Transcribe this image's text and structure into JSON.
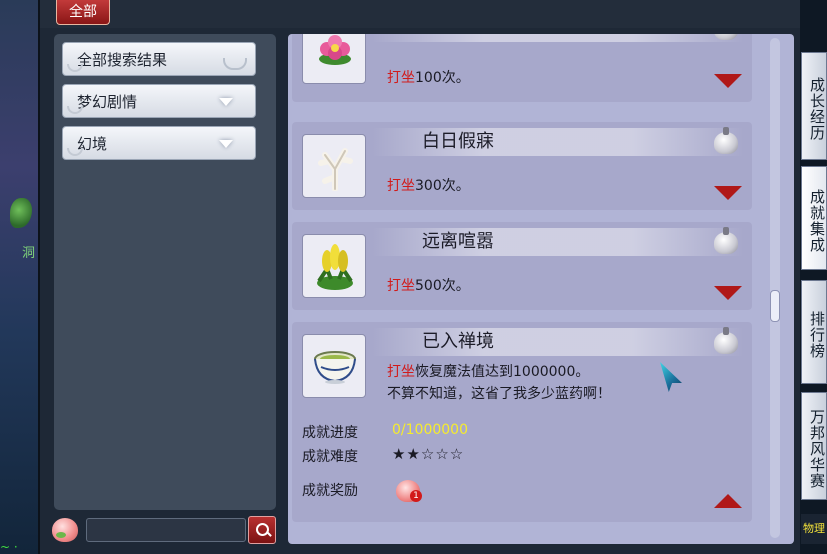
{
  "window": {
    "top_tab": "全部"
  },
  "sidebar": {
    "items": [
      {
        "label": "全部搜索结果",
        "has_dropdown": false
      },
      {
        "label": "梦幻剧情",
        "has_dropdown": true
      },
      {
        "label": "幻境",
        "has_dropdown": true
      }
    ]
  },
  "search": {
    "value": ""
  },
  "achievements": [
    {
      "title": "",
      "action": "打坐",
      "desc": "100次。",
      "icon": "flower-icon",
      "expanded": false
    },
    {
      "title": "白日假寐",
      "action": "打坐",
      "desc": "300次。",
      "icon": "white-coral-icon",
      "expanded": false
    },
    {
      "title": "远离喧嚣",
      "action": "打坐",
      "desc": "500次。",
      "icon": "yellow-plant-icon",
      "expanded": false
    },
    {
      "title": "已入禅境",
      "action": "打坐",
      "desc": "恢复魔法值达到1000000。",
      "desc2": "不算不知道，这省了我多少蓝药啊！",
      "icon": "bowl-icon",
      "expanded": true,
      "progress_label": "成就进度",
      "progress_value": "0/1000000",
      "difficulty_label": "成就难度",
      "difficulty_stars": "★★☆☆☆",
      "reward_label": "成就奖励",
      "reward_badge": "1"
    }
  ],
  "side_menu": [
    {
      "label": "成长经历"
    },
    {
      "label": "成就集成"
    },
    {
      "label": "排行榜"
    },
    {
      "label": "万邦风华赛"
    }
  ],
  "side_bottom": "物理",
  "bg": {
    "left_glyph": "洞",
    "bottom_green": "~ ·"
  },
  "colors": {
    "accent_red": "#b01818",
    "progress_yellow": "#f6ec2c",
    "panel": "#b1b4d6"
  }
}
